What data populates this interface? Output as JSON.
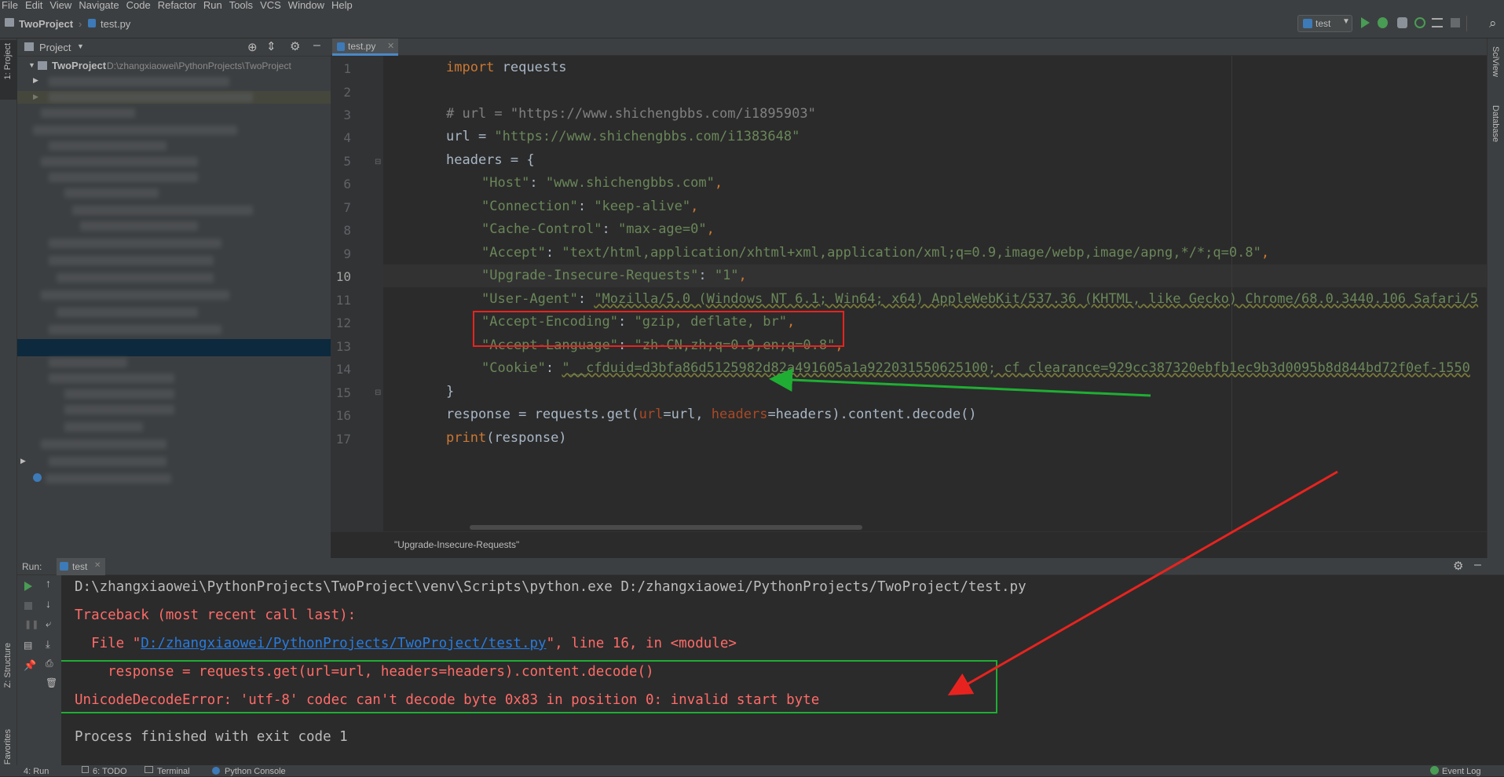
{
  "menu": [
    "File",
    "Edit",
    "View",
    "Navigate",
    "Code",
    "Refactor",
    "Run",
    "Tools",
    "VCS",
    "Window",
    "Help"
  ],
  "nav": {
    "project": "TwoProject",
    "file": "test.py",
    "run_config": "test"
  },
  "left_strip": {
    "project": "1: Project",
    "structure": "Z: Structure",
    "favorites": "2: Favorites"
  },
  "right_strip": {
    "sciview": "SciView",
    "database": "Database"
  },
  "project_panel": {
    "header": "Project",
    "root_name": "TwoProject",
    "root_path": "D:\\zhangxiaowei\\PythonProjects\\TwoProject"
  },
  "editor": {
    "tab": "test.py",
    "line_numbers": [
      "1",
      "2",
      "3",
      "4",
      "5",
      "6",
      "7",
      "8",
      "9",
      "10",
      "11",
      "12",
      "13",
      "14",
      "15",
      "16",
      "17"
    ],
    "breadcrumb": "\"Upgrade-Insecure-Requests\"",
    "lines": {
      "l1": {
        "kw": "import",
        "rest": " requests"
      },
      "l3": "# url = \"https://www.shichengbbs.com/i1895903\"",
      "l4": {
        "a": "url = ",
        "s": "\"https://www.shichengbbs.com/i1383648\""
      },
      "l5": "headers = {",
      "l6": {
        "k": "\"Host\"",
        "c": ": ",
        "v": "\"www.shichengbbs.com\"",
        "e": ","
      },
      "l7": {
        "k": "\"Connection\"",
        "c": ": ",
        "v": "\"keep-alive\"",
        "e": ","
      },
      "l8": {
        "k": "\"Cache-Control\"",
        "c": ": ",
        "v": "\"max-age=0\"",
        "e": ","
      },
      "l9": {
        "k": "\"Accept\"",
        "c": ": ",
        "v": "\"text/html,application/xhtml+xml,application/xml;q=0.9,image/webp,image/apng,*/*;q=0.8\"",
        "e": ","
      },
      "l10": {
        "k": "\"Upgrade-Insecure-Requests\"",
        "c": ": ",
        "v": "\"1\"",
        "e": ","
      },
      "l11": {
        "k": "\"User-Agent\"",
        "c": ": ",
        "v": "\"Mozilla/5.0 (Windows NT 6.1; Win64; x64) AppleWebKit/537.36 (KHTML, like Gecko) Chrome/68.0.3440.106 Safari/5"
      },
      "l12": {
        "k": "\"Accept-Encoding\"",
        "c": ": ",
        "v": "\"gzip, deflate, br\"",
        "e": ","
      },
      "l13": {
        "k": "\"Accept-Language\"",
        "c": ": ",
        "v": "\"zh-CN,zh;q=0.9,en;q=0.8\"",
        "e": ","
      },
      "l14": {
        "k": "\"Cookie\"",
        "c": ": ",
        "v": "\"__cfduid=d3bfa86d5125982d82a491605a1a922031550625100; cf_clearance=929cc387320ebfb1ec9b3d0095b8d844bd72f0ef-1550"
      },
      "l15": "}",
      "l16": {
        "a": "response = requests.get(",
        "p1": "url",
        "b": "=url, ",
        "p2": "headers",
        "c": "=headers).content.decode()"
      },
      "l17": {
        "f": "print",
        "r": "(response)"
      }
    }
  },
  "run": {
    "label": "Run:",
    "tab": "test",
    "cmd": "D:\\zhangxiaowei\\PythonProjects\\TwoProject\\venv\\Scripts\\python.exe D:/zhangxiaowei/PythonProjects/TwoProject/test.py",
    "traceback": "Traceback (most recent call last):",
    "file_pre": "  File \"",
    "file_link": "D:/zhangxiaowei/PythonProjects/TwoProject/test.py",
    "file_post": "\", line 16, in <module>",
    "code_line": "    response = requests.get(url=url, headers=headers).content.decode()",
    "error": "UnicodeDecodeError: 'utf-8' codec can't decode byte 0x83 in position 0: invalid start byte",
    "finished": "Process finished with exit code 1"
  },
  "statusbar": {
    "run": "4: Run",
    "todo": "6: TODO",
    "terminal": "Terminal",
    "console": "Python Console",
    "event_log": "Event Log"
  },
  "colors": {
    "annotation_red": "#e8231f",
    "annotation_green": "#1fae33",
    "keyword": "#cc7832",
    "string": "#6a8759",
    "comment": "#808080",
    "error": "#ff6b68",
    "link": "#287bde"
  }
}
